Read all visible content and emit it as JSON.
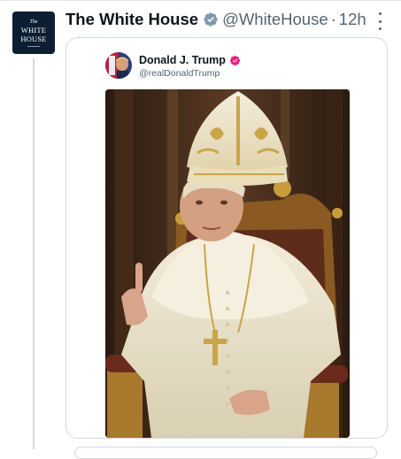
{
  "post": {
    "display_name": "The White House",
    "handle": "@WhiteHouse",
    "separator": "·",
    "time": "12h",
    "avatar": {
      "lines": [
        "The",
        "WHITE",
        "HOUSE"
      ],
      "background": "#0d1e33"
    },
    "verified_badge_color": "#829aab"
  },
  "quoted_post": {
    "display_name": "Donald J. Trump",
    "handle": "@realDonaldTrump",
    "verified_badge_color": "#f91880"
  },
  "colors": {
    "text_primary": "#0f1419",
    "text_secondary": "#536471",
    "border": "#cfd9de"
  }
}
